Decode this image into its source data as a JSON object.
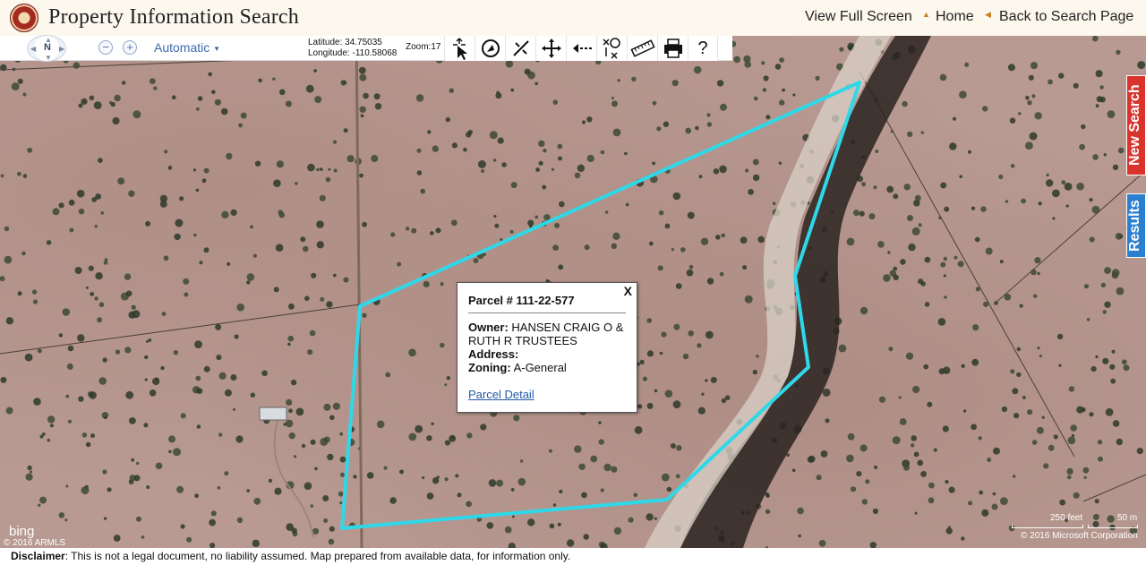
{
  "header": {
    "title": "Property Information Search",
    "view_full_screen": "View Full Screen",
    "home": "Home",
    "back": "Back to Search Page"
  },
  "toolbar": {
    "compass_label": "N",
    "zoom_out": "−",
    "zoom_in": "+",
    "map_mode": "Automatic",
    "latitude": "Latitude: 34.75035",
    "longitude": "Longitude: -110.58068",
    "zoom": "Zoom:17",
    "tools": [
      "select-pointer-icon",
      "lasso-select-icon",
      "clear-selection-icon",
      "pan-icon",
      "back-extent-icon",
      "identify-icon",
      "measure-ruler-icon",
      "print-icon",
      "help-icon"
    ],
    "help_symbol": "?"
  },
  "side_tabs": {
    "new_search": "New Search",
    "results": "Results"
  },
  "popup": {
    "close": "X",
    "parcel": "Parcel # 111-22-577",
    "owner_label": "Owner:",
    "owner_value": "HANSEN CRAIG O & RUTH R TRUSTEES",
    "address_label": "Address:",
    "address_value": "",
    "zoning_label": "Zoning:",
    "zoning_value": "A-General",
    "link": "Parcel Detail"
  },
  "map": {
    "bing": "bing",
    "armls": "© 2016 ARMLS",
    "scale_feet": "250 feet",
    "scale_m": "50 m",
    "copyright": "© 2016 Microsoft Corporation",
    "parcel_color": "#2fd8e8"
  },
  "footer": {
    "label": "Disclaimer",
    "text": ": This is not a legal document, no liability assumed. Map prepared from available data, for information only."
  }
}
